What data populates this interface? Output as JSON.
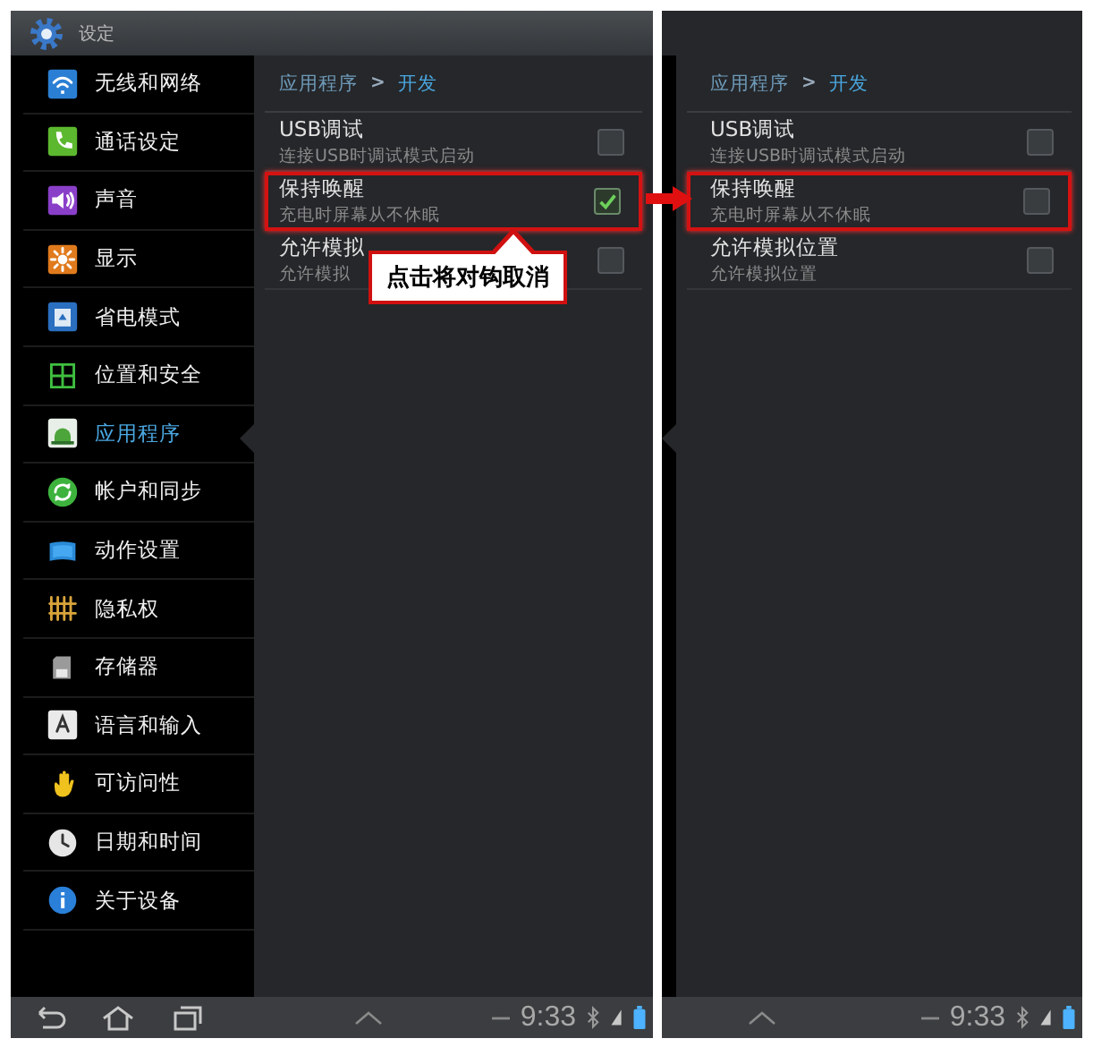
{
  "screens": [
    {
      "kind": "full",
      "title": "设定",
      "sidebar": [
        {
          "label": "无线和网络",
          "selected": false
        },
        {
          "label": "通话设定",
          "selected": false
        },
        {
          "label": "声音",
          "selected": false
        },
        {
          "label": "显示",
          "selected": false
        },
        {
          "label": "省电模式",
          "selected": false
        },
        {
          "label": "位置和安全",
          "selected": false
        },
        {
          "label": "应用程序",
          "selected": true
        },
        {
          "label": "帐户和同步",
          "selected": false
        },
        {
          "label": "动作设置",
          "selected": false
        },
        {
          "label": "隐私权",
          "selected": false
        },
        {
          "label": "存储器",
          "selected": false
        },
        {
          "label": "语言和输入",
          "selected": false
        },
        {
          "label": "可访问性",
          "selected": false
        },
        {
          "label": "日期和时间",
          "selected": false
        },
        {
          "label": "关于设备",
          "selected": false
        }
      ],
      "breadcrumb": [
        "应用程序",
        "开发"
      ],
      "separator": ">",
      "settings": [
        {
          "title": "USB调试",
          "subtitle": "连接USB时调试模式启动",
          "checked": false,
          "highlighted": false
        },
        {
          "title": "保持唤醒",
          "subtitle": "充电时屏幕从不休眠",
          "checked": true,
          "highlighted": true
        },
        {
          "title": "允许模拟",
          "subtitle": "允许模拟",
          "checked": false,
          "highlighted": false
        }
      ],
      "time": "9:33"
    },
    {
      "kind": "content",
      "breadcrumb": [
        "应用程序",
        "开发"
      ],
      "separator": ">",
      "settings": [
        {
          "title": "USB调试",
          "subtitle": "连接USB时调试模式启动",
          "checked": false,
          "highlighted": false
        },
        {
          "title": "保持唤醒",
          "subtitle": "充电时屏幕从不休眠",
          "checked": false,
          "highlighted": true
        },
        {
          "title": "允许模拟位置",
          "subtitle": "允许模拟位置",
          "checked": false,
          "highlighted": false
        }
      ],
      "time": "9:33"
    }
  ],
  "callout": "点击将对钩取消"
}
